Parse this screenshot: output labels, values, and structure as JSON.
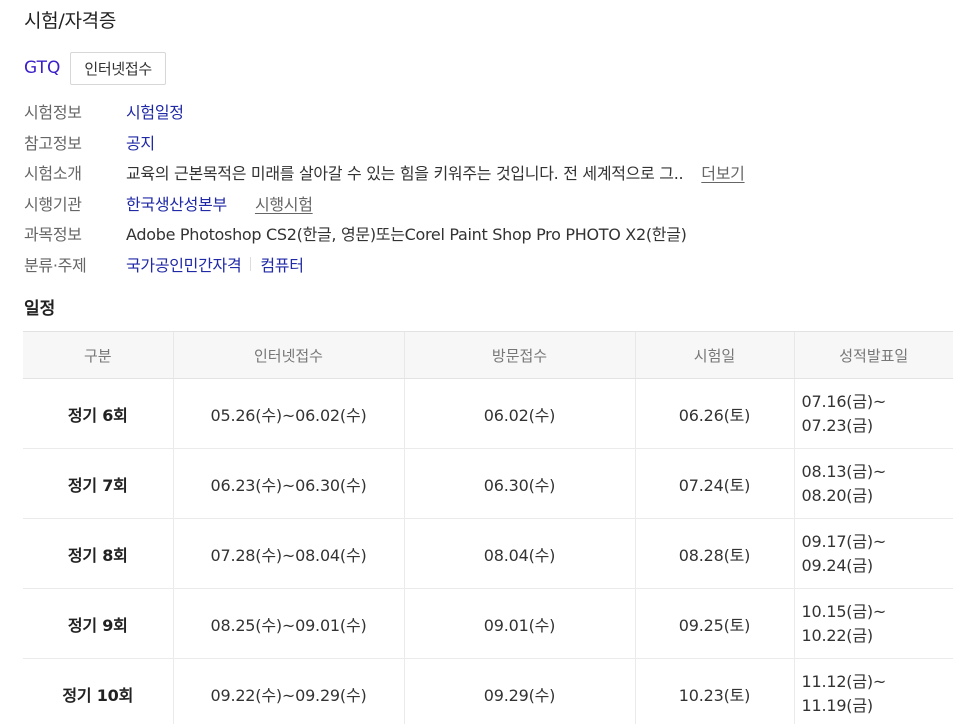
{
  "category": {
    "title": "시험/자격증"
  },
  "exam": {
    "name": "GTQ",
    "apply_button": "인터넷접수"
  },
  "info": {
    "exam_info": {
      "label": "시험정보",
      "link": "시험일정"
    },
    "reference": {
      "label": "참고정보",
      "link": "공지"
    },
    "intro": {
      "label": "시험소개",
      "text": "교육의 근본목적은 미래를 살아갈 수 있는 힘을 키워주는 것입니다. 전 세계적으로 그..",
      "more": "더보기"
    },
    "agency": {
      "label": "시행기관",
      "link": "한국생산성본부",
      "link2": "시행시험"
    },
    "subject": {
      "label": "과목정보",
      "text": "Adobe Photoshop CS2(한글, 영문)또는Corel Paint Shop Pro PHOTO X2(한글)"
    },
    "classification": {
      "label": "분류·주제",
      "link": "국가공인민간자격",
      "link2": "컴퓨터"
    }
  },
  "schedule": {
    "title": "일정",
    "headers": [
      "구분",
      "인터넷접수",
      "방문접수",
      "시험일",
      "성적발표일"
    ],
    "rows": [
      {
        "round": "정기 6회",
        "online": "05.26(수)~06.02(수)",
        "visit": "06.02(수)",
        "exam_date": "06.26(토)",
        "result_start": "07.16(금)~",
        "result_end": "07.23(금)"
      },
      {
        "round": "정기 7회",
        "online": "06.23(수)~06.30(수)",
        "visit": "06.30(수)",
        "exam_date": "07.24(토)",
        "result_start": "08.13(금)~",
        "result_end": "08.20(금)"
      },
      {
        "round": "정기 8회",
        "online": "07.28(수)~08.04(수)",
        "visit": "08.04(수)",
        "exam_date": "08.28(토)",
        "result_start": "09.17(금)~",
        "result_end": "09.24(금)"
      },
      {
        "round": "정기 9회",
        "online": "08.25(수)~09.01(수)",
        "visit": "09.01(수)",
        "exam_date": "09.25(토)",
        "result_start": "10.15(금)~",
        "result_end": "10.22(금)"
      },
      {
        "round": "정기 10회",
        "online": "09.22(수)~09.29(수)",
        "visit": "09.29(수)",
        "exam_date": "10.23(토)",
        "result_start": "11.12(금)~",
        "result_end": "11.19(금)"
      }
    ]
  }
}
